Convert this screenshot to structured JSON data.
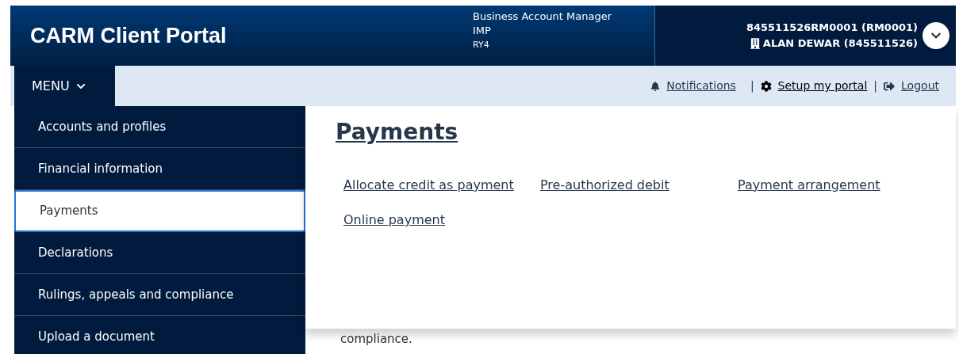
{
  "header": {
    "title": "CARM Client Portal",
    "role_lines": [
      "Business Account Manager",
      "IMP",
      "RY4"
    ],
    "account": "845511526RM0001 (RM0001)",
    "business": "ALAN DEWAR (845511526)"
  },
  "nav": {
    "menu_label": "MENU",
    "separator": "|",
    "links": [
      {
        "kind": "notifications",
        "label": "Notifications"
      },
      {
        "kind": "setup",
        "label": "Setup my portal"
      },
      {
        "kind": "logout",
        "label": "Logout"
      }
    ]
  },
  "sidebar": {
    "items": [
      {
        "label": "Accounts and profiles",
        "selected": false
      },
      {
        "label": "Financial information",
        "selected": false
      },
      {
        "label": "Payments",
        "selected": true
      },
      {
        "label": "Declarations",
        "selected": false
      },
      {
        "label": "Rulings, appeals and compliance",
        "selected": false
      },
      {
        "label": "Upload a document",
        "selected": false
      }
    ]
  },
  "panel": {
    "heading": "Payments",
    "links": [
      "Allocate credit as payment",
      "Pre-authorized debit",
      "Payment arrangement",
      "Online payment"
    ]
  },
  "page_text": "compliance."
}
